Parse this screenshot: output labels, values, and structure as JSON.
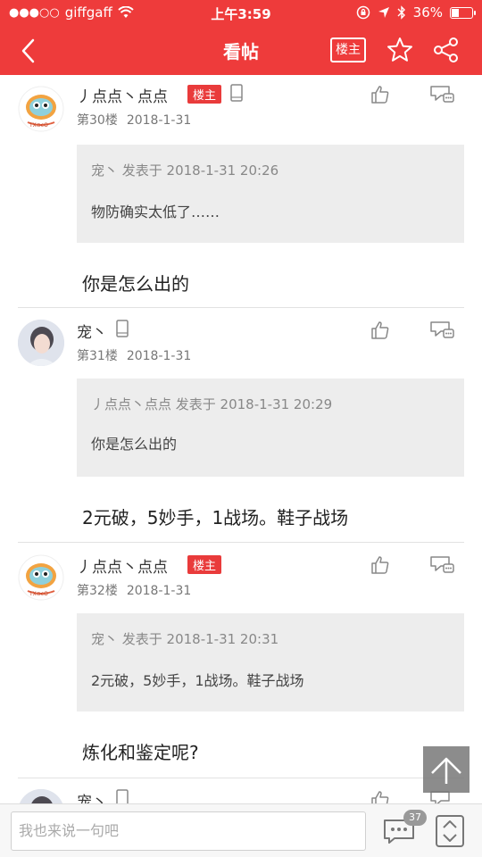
{
  "statusbar": {
    "carrier": "giffgaff",
    "time": "上午3:59",
    "battery": "36%",
    "battery_level": 0.36
  },
  "header": {
    "title": "看帖",
    "op_only_label": "楼主"
  },
  "posts": [
    {
      "username": "丿点点丶点点",
      "is_op": true,
      "op_badge": "楼主",
      "floor": "第30楼",
      "date": "2018-1-31",
      "quote_meta": "宠丶 发表于 2018-1-31 20:26",
      "quote_text": "物防确实太低了……",
      "text": "你是怎么出的"
    },
    {
      "username": "宠丶",
      "is_op": false,
      "floor": "第31楼",
      "date": "2018-1-31",
      "quote_meta": "丿点点丶点点 发表于 2018-1-31 20:29",
      "quote_text": "你是怎么出的",
      "text": "2元破，5妙手，1战场。鞋子战场"
    },
    {
      "username": "丿点点丶点点",
      "is_op": true,
      "op_badge": "楼主",
      "floor": "第32楼",
      "date": "2018-1-31",
      "quote_meta": "宠丶 发表于 2018-1-31 20:31",
      "quote_text": " 2元破，5妙手，1战场。鞋子战场",
      "text": "炼化和鉴定呢?"
    },
    {
      "username": "宠丶",
      "is_op": false
    }
  ],
  "bottom": {
    "input_placeholder": "我也来说一句吧",
    "comment_count": "37"
  },
  "colors": {
    "brand": "#ee3b3b",
    "quote_bg": "#ededed"
  },
  "icons": [
    "back-icon",
    "star-icon",
    "share-icon",
    "like-icon",
    "reply-icon",
    "phone-icon",
    "wifi-icon",
    "comment-icon",
    "scroll-arrows-icon",
    "up-arrow-icon"
  ]
}
